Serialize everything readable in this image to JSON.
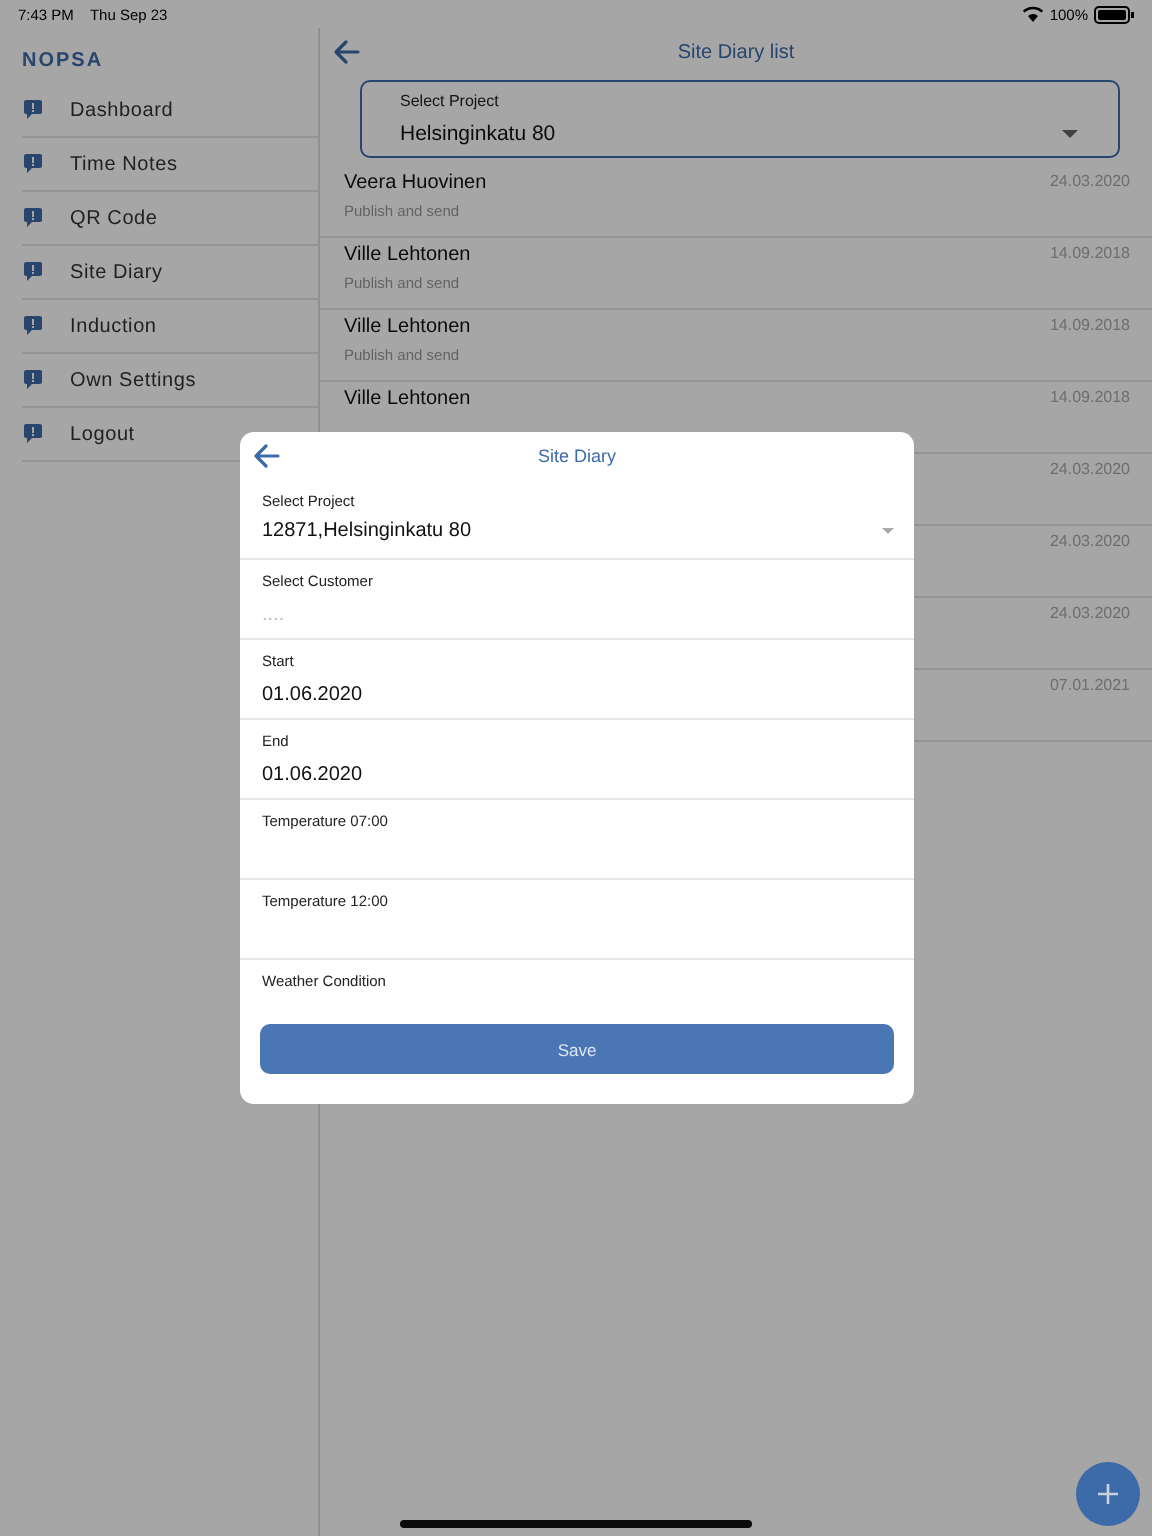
{
  "status_bar": {
    "time": "7:43 PM",
    "date": "Thu Sep 23",
    "battery": "100%"
  },
  "sidebar": {
    "brand": "NOPSA",
    "items": [
      {
        "label": "Dashboard"
      },
      {
        "label": "Time Notes"
      },
      {
        "label": "QR Code"
      },
      {
        "label": "Site Diary"
      },
      {
        "label": "Induction"
      },
      {
        "label": "Own Settings"
      },
      {
        "label": "Logout"
      }
    ]
  },
  "main": {
    "title": "Site Diary list",
    "project_select": {
      "label": "Select Project",
      "value": "Helsinginkatu 80"
    },
    "rows": [
      {
        "name": "Veera Huovinen",
        "subtitle": "Publish and send",
        "date": "24.03.2020"
      },
      {
        "name": "Ville Lehtonen",
        "subtitle": "Publish and send",
        "date": "14.09.2018"
      },
      {
        "name": "Ville Lehtonen",
        "subtitle": "Publish and send",
        "date": "14.09.2018"
      },
      {
        "name": "Ville Lehtonen",
        "date": "14.09.2018"
      },
      {
        "date": "24.03.2020"
      },
      {
        "date": "24.03.2020"
      },
      {
        "date": "24.03.2020"
      },
      {
        "date": "07.01.2021"
      }
    ]
  },
  "dialog": {
    "title": "Site Diary",
    "fields": [
      {
        "kind": "select",
        "label": "Select Project",
        "value": "12871,Helsinginkatu 80"
      },
      {
        "kind": "text",
        "label": "Select Customer",
        "placeholder": "...."
      },
      {
        "kind": "text",
        "label": "Start",
        "value": "01.06.2020"
      },
      {
        "kind": "text",
        "label": "End",
        "value": "01.06.2020"
      },
      {
        "kind": "text",
        "label": "Temperature 07:00"
      },
      {
        "kind": "text",
        "label": "Temperature 12:00"
      },
      {
        "kind": "text",
        "label": "Weather Condition"
      }
    ],
    "save_button": "Save"
  }
}
